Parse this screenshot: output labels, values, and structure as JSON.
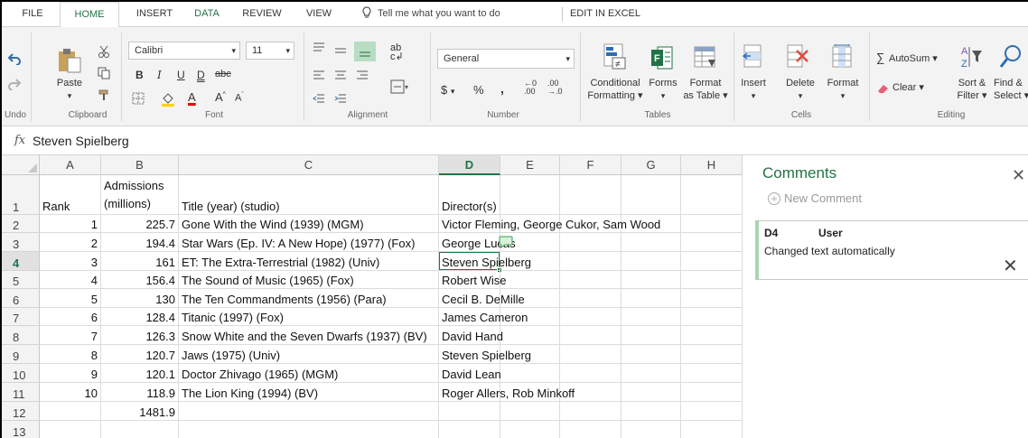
{
  "tabs": [
    "FILE",
    "HOME",
    "INSERT",
    "DATA",
    "REVIEW",
    "VIEW"
  ],
  "tell_me": "Tell me what you want to do",
  "edit_in_excel": "EDIT IN EXCEL",
  "ribbon": {
    "undo_group": "Undo",
    "clipboard": {
      "paste": "Paste",
      "group": "Clipboard"
    },
    "font": {
      "name": "Calibri",
      "size": "11",
      "group": "Font"
    },
    "alignment": {
      "group": "Alignment"
    },
    "number": {
      "format": "General",
      "group": "Number"
    },
    "tables": {
      "conditional": "Conditional",
      "formatting": "Formatting",
      "forms": "Forms",
      "format": "Format",
      "as_table": "as Table",
      "group": "Tables"
    },
    "cells": {
      "insert": "Insert",
      "delete": "Delete",
      "format": "Format",
      "group": "Cells"
    },
    "editing": {
      "autosum": "AutoSum",
      "clear": "Clear",
      "sort1": "Sort &",
      "sort2": "Filter",
      "find1": "Find &",
      "find2": "Select",
      "group": "Editing"
    }
  },
  "formula": {
    "fx": "fx",
    "value": "Steven Spielberg"
  },
  "grid": {
    "columns": [
      "A",
      "B",
      "C",
      "D",
      "E",
      "F",
      "G",
      "H"
    ],
    "rows": [
      {
        "n": "1",
        "a": "Rank",
        "b1": "Admissions",
        "b2": "(millions)",
        "c": "Title (year) (studio)",
        "d": "Director(s)"
      },
      {
        "n": "2",
        "a": "1",
        "b": "225.7",
        "c": "Gone With the Wind (1939) (MGM)",
        "d": "Victor Fleming, George Cukor, Sam Wood"
      },
      {
        "n": "3",
        "a": "2",
        "b": "194.4",
        "c": "Star Wars (Ep. IV: A New Hope) (1977) (Fox)",
        "d": "George Lucas"
      },
      {
        "n": "4",
        "a": "3",
        "b": "161",
        "c": "ET: The Extra-Terrestrial (1982) (Univ)",
        "d": "Steven Spielberg"
      },
      {
        "n": "5",
        "a": "4",
        "b": "156.4",
        "c": "The Sound of Music (1965) (Fox)",
        "d": "Robert Wise"
      },
      {
        "n": "6",
        "a": "5",
        "b": "130",
        "c": "The Ten Commandments (1956) (Para)",
        "d": "Cecil B. DeMille"
      },
      {
        "n": "7",
        "a": "6",
        "b": "128.4",
        "c": "Titanic (1997) (Fox)",
        "d": "James Cameron"
      },
      {
        "n": "8",
        "a": "7",
        "b": "126.3",
        "c": "Snow White and the Seven Dwarfs (1937) (BV)",
        "d": "David Hand"
      },
      {
        "n": "9",
        "a": "8",
        "b": "120.7",
        "c": "Jaws (1975) (Univ)",
        "d": "Steven Spielberg"
      },
      {
        "n": "10",
        "a": "9",
        "b": "120.1",
        "c": "Doctor Zhivago (1965) (MGM)",
        "d": "David Lean"
      },
      {
        "n": "11",
        "a": "10",
        "b": "118.9",
        "c": "The Lion King (1994) (BV)",
        "d": "Roger Allers, Rob Minkoff"
      },
      {
        "n": "12",
        "a": "",
        "b": "1481.9",
        "c": "",
        "d": ""
      },
      {
        "n": "13",
        "a": "",
        "b": "",
        "c": "",
        "d": ""
      }
    ]
  },
  "comments": {
    "title": "Comments",
    "new_comment": "New Comment",
    "ref": "D4",
    "user": "User",
    "text": "Changed text automatically"
  },
  "colors": {
    "accent": "#217346",
    "comment_bar": "#a9d5b4"
  }
}
